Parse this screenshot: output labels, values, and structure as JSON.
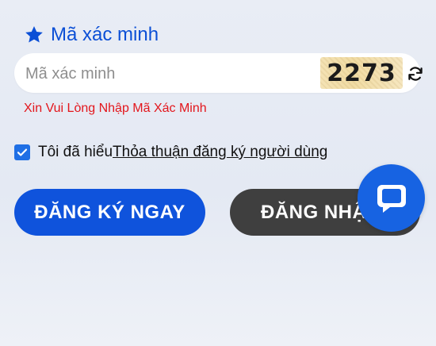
{
  "captcha": {
    "label": "Mã xác minh",
    "placeholder": "Mã xác minh",
    "code": "2273",
    "error": "Xin Vui Lòng Nhập Mã Xác Minh"
  },
  "agreement": {
    "prefix": "Tôi đã hiểu",
    "link": "Thỏa thuận đăng ký người dùng",
    "checked": true
  },
  "buttons": {
    "register": "ĐĂNG KÝ NGAY",
    "login": "ĐĂNG NHẬP"
  },
  "icons": {
    "label": "star-icon",
    "refresh": "refresh-icon",
    "checkbox": "check-icon",
    "chat": "chat-bubble-icon"
  },
  "colors": {
    "primary": "#0f53dc",
    "label": "#0b4fd6",
    "error": "#e3161c",
    "login_bg": "#3f3f3f",
    "chat_fab": "#1763e2",
    "captcha_bg": "#f4e3b5"
  }
}
